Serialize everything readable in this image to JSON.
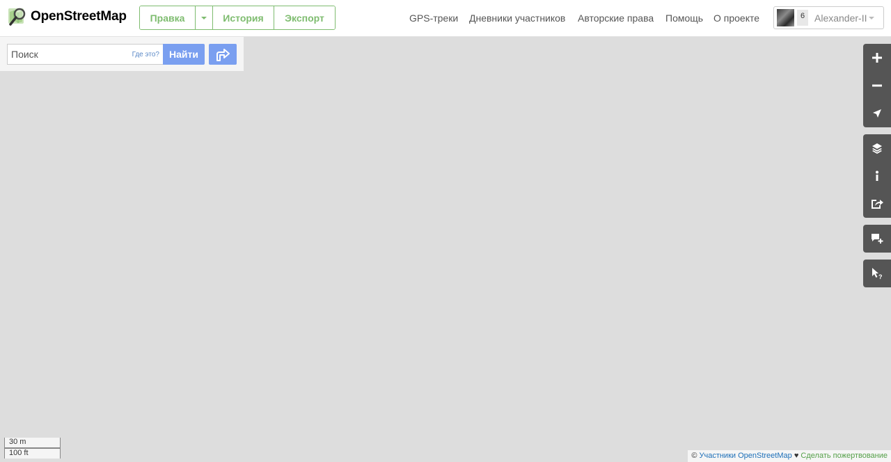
{
  "header": {
    "logo_text": "OpenStreetMap",
    "edit_label": "Правка",
    "history_label": "История",
    "export_label": "Экспорт",
    "nav": {
      "gps": "GPS-треки",
      "diaries": "Дневники участников",
      "copyright": "Авторские права",
      "help": "Помощь",
      "about": "О проекте"
    },
    "user": {
      "message_count": "6",
      "name": "Alexander-II"
    }
  },
  "search": {
    "placeholder": "Поиск",
    "where_link": "Где это?",
    "button_label": "Найти"
  },
  "scale": {
    "metric": "30 m",
    "imperial": "100 ft"
  },
  "attribution": {
    "prefix": "©",
    "contributors": "Участники OpenStreetMap",
    "heart": "♥",
    "donate": "Сделать пожертвование"
  },
  "colors": {
    "brand_green": "#7ebc6f",
    "search_blue": "#7a9ff0",
    "control_gray": "#555555",
    "map_background": "#dddddd"
  },
  "icons": {
    "zoom_in": "plus-icon",
    "zoom_out": "minus-icon",
    "locate": "location-arrow-icon",
    "layers": "layers-icon",
    "map_key": "info-icon",
    "share": "share-icon",
    "add_note": "note-add-icon",
    "query": "query-cursor-icon",
    "directions": "directions-icon"
  }
}
